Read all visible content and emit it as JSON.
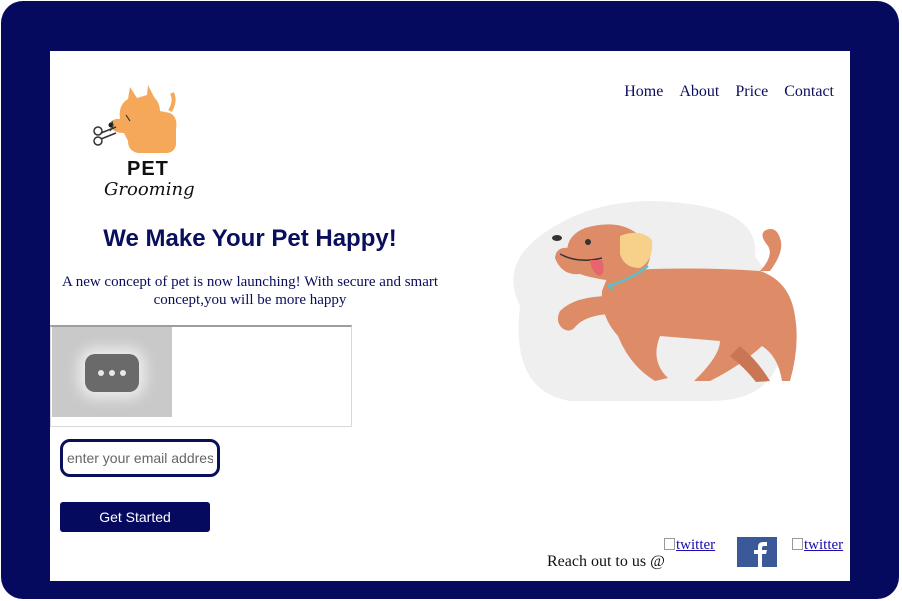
{
  "nav": {
    "items": [
      "Home",
      "About",
      "Price",
      "Contact"
    ]
  },
  "logo": {
    "line1": "PET",
    "line2": "Grooming"
  },
  "hero": {
    "title": "We Make Your Pet Happy!",
    "description": "A new concept of pet is now launching! With secure and smart concept,you will be more happy"
  },
  "signup": {
    "email_placeholder": "enter your email address",
    "cta_label": "Get Started"
  },
  "footer": {
    "reach_text": "Reach out to us @",
    "social": {
      "twitter_alt_1": "twitter",
      "facebook": "facebook-icon",
      "twitter_alt_2": "twitter"
    }
  },
  "colors": {
    "navy": "#050a5e",
    "dog": "#de8b68",
    "blob": "#efefef",
    "logo_dog": "#f5a85a",
    "facebook": "#3b5998"
  }
}
